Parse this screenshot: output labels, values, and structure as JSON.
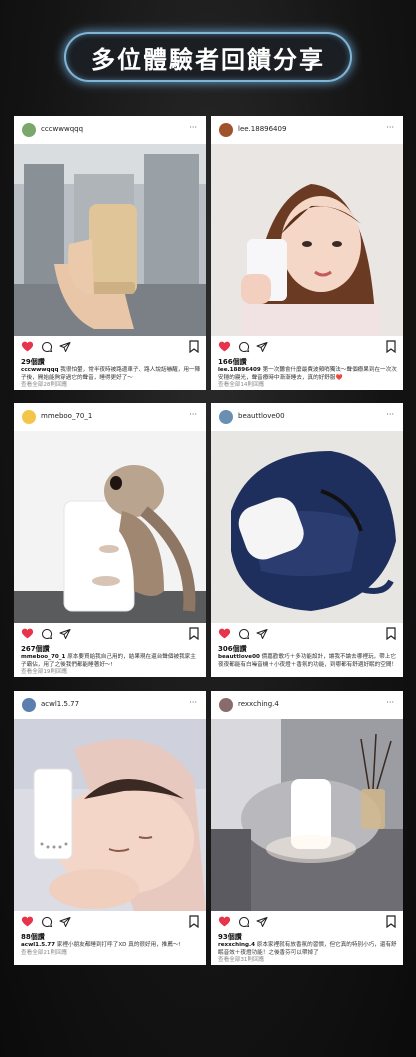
{
  "banner": {
    "title": "多位體驗者回饋分享"
  },
  "posts": [
    {
      "username": "cccwwwqqq",
      "likes": "29個讚",
      "caption_user": "cccwwwqqq",
      "caption": "我很怕暈，常半夜時被路邊車子、路人說話嚇醒，用一陣子後，開始能夠穿過它的聲音，睡得更好了～",
      "view_all": "查看全部28則回應",
      "more_icon": "more-dots"
    },
    {
      "username": "lee.18896409",
      "likes": "166個讚",
      "caption_user": "lee.18896409",
      "caption": "第一次聽會什麼最費波頻哨獨法～聲個療果到在一次次安穩的寢光，聲音療時中漸漸睡去，真的好舒服❤️",
      "view_all": "查看全部14則回應",
      "more_icon": "more-dots"
    },
    {
      "username": "mmeboo_70_1",
      "likes": "267個讚",
      "caption_user": "mmeboo_70_1",
      "caption": "原本要買給我自己用的，結果現在還台聲個被我家主子霸佔，用了之後我們都能睡著好～!",
      "view_all": "查看全部19則回應",
      "more_icon": "more-dots"
    },
    {
      "username": "beauttlove00",
      "likes": "306個讚",
      "caption_user": "beauttlove00",
      "caption": "價嘉歡歌巧＋多功能設計，讓我不論去哪裡玩，帶上它夜夜都能有白噪音機＋小夜燈＋香氛的功能，到哪都有舒適好眠的空間！",
      "view_all": "",
      "more_icon": "more-dots"
    },
    {
      "username": "acwl1.5.77",
      "likes": "88個讚",
      "caption_user": "acwl1.5.77",
      "caption": "家裡小朋友都睡到打呼了XD 真的很好用，推薦～!",
      "view_all": "查看全部21則回應",
      "more_icon": "more-dots"
    },
    {
      "username": "rexxching.4",
      "likes": "93個讚",
      "caption_user": "rexxching.4",
      "caption": "原本家裡就有放香氛的習慣，但它真的特別小巧，還有舒眠音效＋夜燈功能！之後香芬可以帶掉了",
      "view_all": "查看全部31則回應",
      "more_icon": "more-dots"
    }
  ],
  "colors": {
    "heart": "#e8344a",
    "banner_glow": "#7fb6d8",
    "background": "#141414"
  }
}
